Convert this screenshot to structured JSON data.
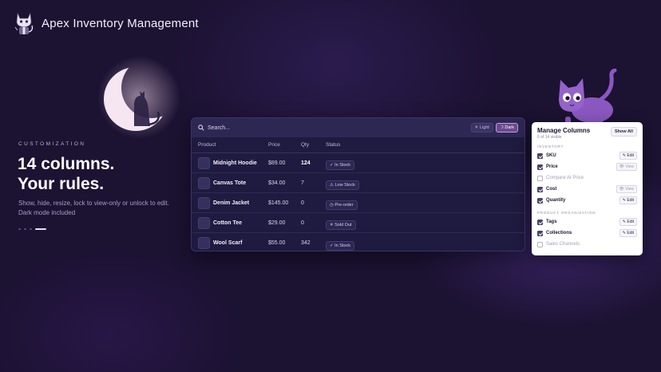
{
  "app": {
    "title": "Apex Inventory Management"
  },
  "hero": {
    "eyebrow": "CUSTOMIZATION",
    "headline_line1": "14 columns.",
    "headline_line2": "Your rules.",
    "subtext_line1": "Show, hide, resize, lock to view-only or unlock to edit.",
    "subtext_line2": "Dark mode included",
    "carousel_dots": 4,
    "carousel_active_index": 3
  },
  "table": {
    "search_placeholder": "Search...",
    "theme_light": "☀ Light",
    "theme_dark": "☽ Dark",
    "active_theme": "dark",
    "columns": [
      "Product",
      "Price",
      "Qty",
      "Status"
    ],
    "rows": [
      {
        "product": "Midnight Hoodie",
        "price": "$89.00",
        "qty": "124",
        "status": "✓ In Stock"
      },
      {
        "product": "Canvas Tote",
        "price": "$34.00",
        "qty": "7",
        "status": "⚠ Low Stock"
      },
      {
        "product": "Denim Jacket",
        "price": "$145.00",
        "qty": "0",
        "status": "◷ Pre-order"
      },
      {
        "product": "Cotton Tee",
        "price": "$29.00",
        "qty": "0",
        "status": "✕ Sold Out"
      },
      {
        "product": "Wool Scarf",
        "price": "$55.00",
        "qty": "342",
        "status": "✓ In Stock"
      }
    ]
  },
  "manage_columns": {
    "title": "Manage Columns",
    "subtitle": "6 of 14 visible",
    "show_all": "Show All",
    "sections": [
      {
        "name": "INVENTORY",
        "items": [
          {
            "label": "SKU",
            "checked": true,
            "mode": "✎ Edit"
          },
          {
            "label": "Price",
            "checked": true,
            "mode": "👁 View"
          },
          {
            "label": "Compare At Price",
            "checked": false,
            "mode": ""
          },
          {
            "label": "Cost",
            "checked": true,
            "mode": "👁 View"
          },
          {
            "label": "Quantity",
            "checked": true,
            "mode": "✎ Edit"
          }
        ]
      },
      {
        "name": "PRODUCT ORGANIZATION",
        "items": [
          {
            "label": "Tags",
            "checked": true,
            "mode": "✎ Edit"
          },
          {
            "label": "Collections",
            "checked": true,
            "mode": "✎ Edit"
          },
          {
            "label": "Sales Channels",
            "checked": false,
            "mode": ""
          }
        ]
      }
    ]
  },
  "colors": {
    "background": "#1c1232",
    "accent": "#9b6fd0",
    "panel": "#1f1a3f"
  },
  "icons": [
    "cat-mascot-icon",
    "moon-cat-illustration",
    "search-icon",
    "peeking-cat-illustration"
  ]
}
